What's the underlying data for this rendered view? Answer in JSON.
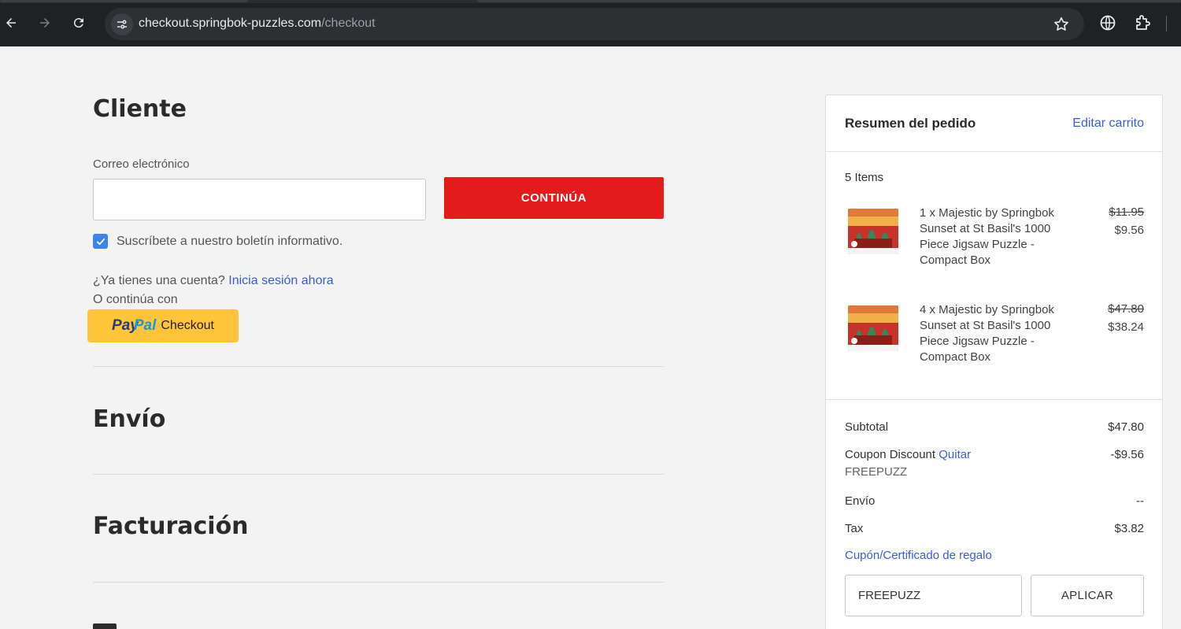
{
  "browser": {
    "url_host": "checkout.springbok-puzzles.com",
    "url_path": "/checkout"
  },
  "customer": {
    "title": "Cliente",
    "email_label": "Correo electrónico",
    "email_value": "",
    "continue_label": "CONTINÚA",
    "newsletter_label": "Suscríbete a nuestro boletín informativo.",
    "newsletter_checked": true,
    "account_prompt": "¿Ya tienes una cuenta?",
    "signin_link": "Inicia sesión ahora",
    "or_continue": "O continúa con",
    "paypal_word1": "Pay",
    "paypal_word2": "Pal",
    "paypal_checkout": "Checkout"
  },
  "sections": {
    "shipping_title": "Envío",
    "billing_title": "Facturación"
  },
  "summary": {
    "title": "Resumen del pedido",
    "edit_link": "Editar carrito",
    "items_count": "5 Items",
    "items": [
      {
        "name": "1 x Majestic by Springbok Sunset at St Basil's 1000 Piece Jigsaw Puzzle - Compact Box",
        "old_price": "$11.95",
        "new_price": "$9.56"
      },
      {
        "name": "4 x Majestic by Springbok Sunset at St Basil's 1000 Piece Jigsaw Puzzle - Compact Box",
        "old_price": "$47.80",
        "new_price": "$38.24"
      }
    ],
    "subtotal_label": "Subtotal",
    "subtotal_value": "$47.80",
    "coupon_label": "Coupon Discount",
    "coupon_remove": "Quitar",
    "coupon_value": "-$9.56",
    "coupon_code": "FREEPUZZ",
    "shipping_label": "Envío",
    "shipping_value": "--",
    "tax_label": "Tax",
    "tax_value": "$3.82",
    "gift_link": "Cupón/Certificado de regalo",
    "coupon_input_value": "FREEPUZZ",
    "apply_label": "APLICAR"
  },
  "colors": {
    "accent_red": "#e31b1b",
    "link_blue": "#3b5ddd",
    "checkbox_blue": "#3d82f0",
    "paypal_yellow": "#ffc439"
  }
}
